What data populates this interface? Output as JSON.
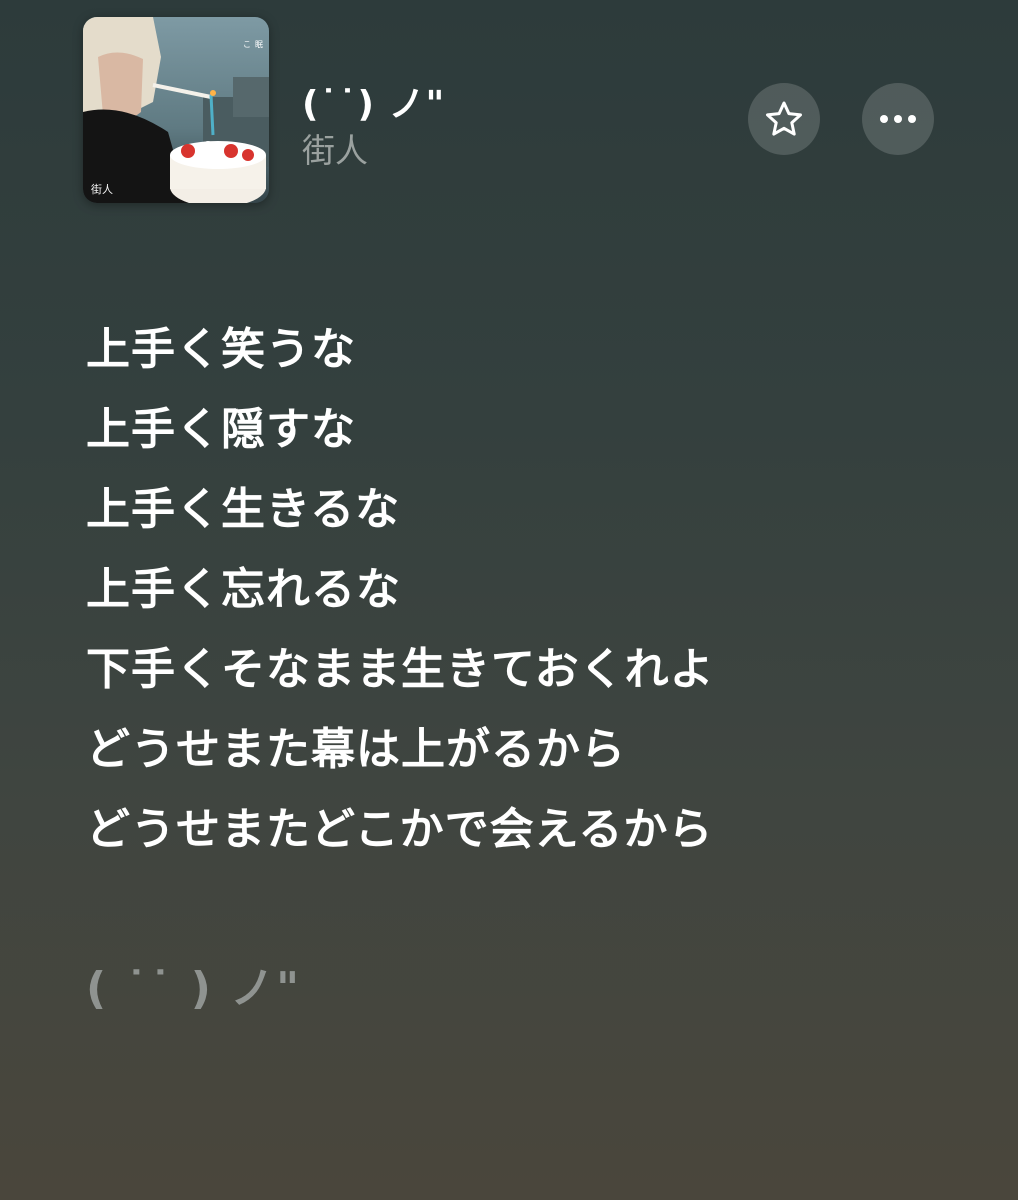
{
  "song": {
    "title": "(˙˙) ノ\"",
    "artist": "街人",
    "artwork_label": "街人"
  },
  "actions": {
    "favorite_icon": "star-outline-icon",
    "more_icon": "ellipsis-icon"
  },
  "lyrics": {
    "lines": [
      "上手く笑うな",
      "上手く隠すな",
      "上手く生きるな",
      "上手く忘れるな",
      "下手くそなまま生きておくれよ",
      "どうせまた幕は上がるから",
      "どうせまたどこかで会えるから"
    ],
    "next_line": "( ˙˙ ) ノ\""
  },
  "colors": {
    "background_top": "#2d3b3b",
    "background_bottom": "#4a463c",
    "lyric_active": "#ffffff",
    "lyric_inactive": "#8f9390",
    "artist_text": "#9aa19f"
  }
}
